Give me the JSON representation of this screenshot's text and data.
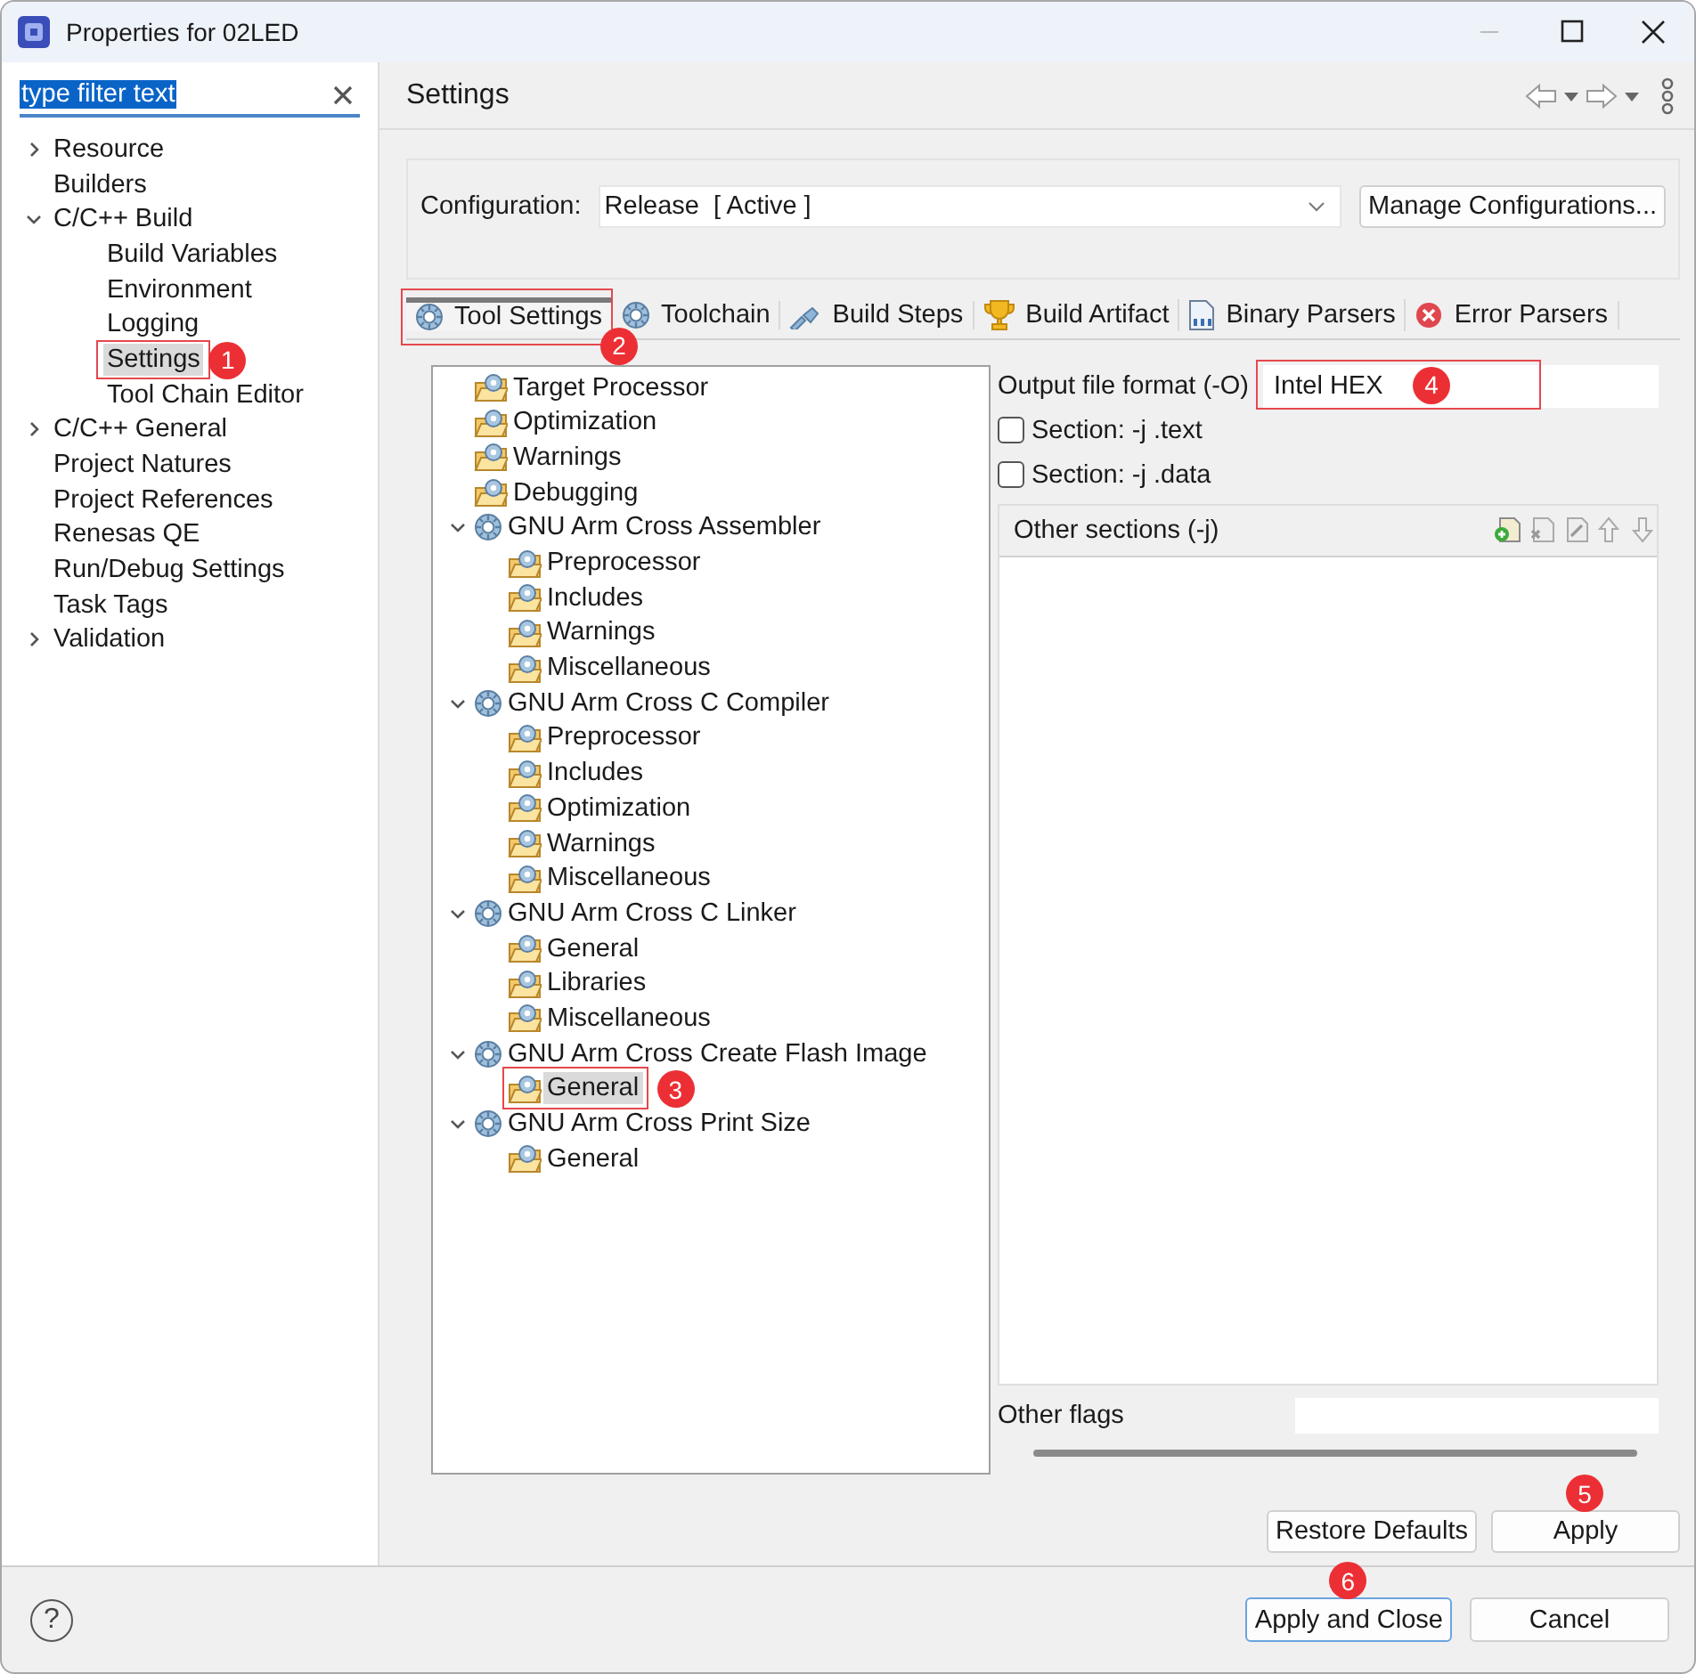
{
  "window": {
    "title": "Properties for 02LED"
  },
  "filter": {
    "value": "type filter text",
    "selected": true
  },
  "sidebar": {
    "items": [
      {
        "label": "Resource",
        "expanded": false,
        "selected": false
      },
      {
        "label": "Builders",
        "selected": false
      },
      {
        "label": "C/C++ Build",
        "expanded": true,
        "selected": false,
        "children": [
          {
            "label": "Build Variables",
            "selected": false
          },
          {
            "label": "Environment",
            "selected": false
          },
          {
            "label": "Logging",
            "selected": false
          },
          {
            "label": "Settings",
            "selected": true,
            "callout": {
              "number": "1",
              "boxed": true
            }
          },
          {
            "label": "Tool Chain Editor",
            "selected": false
          }
        ]
      },
      {
        "label": "C/C++ General",
        "expanded": false,
        "selected": false
      },
      {
        "label": "Project Natures",
        "selected": false
      },
      {
        "label": "Project References",
        "selected": false
      },
      {
        "label": "Renesas QE",
        "selected": false
      },
      {
        "label": "Run/Debug Settings",
        "selected": false
      },
      {
        "label": "Task Tags",
        "selected": false
      },
      {
        "label": "Validation",
        "expanded": false,
        "selected": false
      }
    ]
  },
  "page_title": "Settings",
  "configuration": {
    "label": "Configuration:",
    "value": "Release  [ Active ]",
    "button": "Manage Configurations..."
  },
  "tabs": [
    {
      "label": "Tool Settings",
      "selected": true,
      "callout": {
        "number": "2",
        "boxed": true
      }
    },
    {
      "label": "Toolchain",
      "selected": false
    },
    {
      "label": "Build Steps",
      "selected": false
    },
    {
      "label": "Build Artifact",
      "selected": false
    },
    {
      "label": "Binary Parsers",
      "selected": false
    },
    {
      "label": "Error Parsers",
      "selected": false
    }
  ],
  "tool_tree": {
    "items": [
      {
        "label": "Target Processor",
        "kind": "category",
        "selected": false
      },
      {
        "label": "Optimization",
        "kind": "category",
        "selected": false
      },
      {
        "label": "Warnings",
        "kind": "category",
        "selected": false
      },
      {
        "label": "Debugging",
        "kind": "category",
        "selected": false
      },
      {
        "label": "GNU Arm Cross Assembler",
        "kind": "tool",
        "expanded": true,
        "selected": false,
        "children": [
          {
            "label": "Preprocessor",
            "kind": "category",
            "selected": false
          },
          {
            "label": "Includes",
            "kind": "category",
            "selected": false
          },
          {
            "label": "Warnings",
            "kind": "category",
            "selected": false
          },
          {
            "label": "Miscellaneous",
            "kind": "category",
            "selected": false
          }
        ]
      },
      {
        "label": "GNU Arm Cross C Compiler",
        "kind": "tool",
        "expanded": true,
        "selected": false,
        "children": [
          {
            "label": "Preprocessor",
            "kind": "category",
            "selected": false
          },
          {
            "label": "Includes",
            "kind": "category",
            "selected": false
          },
          {
            "label": "Optimization",
            "kind": "category",
            "selected": false
          },
          {
            "label": "Warnings",
            "kind": "category",
            "selected": false
          },
          {
            "label": "Miscellaneous",
            "kind": "category",
            "selected": false
          }
        ]
      },
      {
        "label": "GNU Arm Cross C Linker",
        "kind": "tool",
        "expanded": true,
        "selected": false,
        "children": [
          {
            "label": "General",
            "kind": "category",
            "selected": false
          },
          {
            "label": "Libraries",
            "kind": "category",
            "selected": false
          },
          {
            "label": "Miscellaneous",
            "kind": "category",
            "selected": false
          }
        ]
      },
      {
        "label": "GNU Arm Cross Create Flash Image",
        "kind": "tool",
        "expanded": true,
        "selected": false,
        "children": [
          {
            "label": "General",
            "kind": "category",
            "selected": true,
            "callout": {
              "number": "3",
              "boxed": true
            }
          }
        ]
      },
      {
        "label": "GNU Arm Cross Print Size",
        "kind": "tool",
        "expanded": true,
        "selected": false,
        "children": [
          {
            "label": "General",
            "kind": "category",
            "selected": false
          }
        ]
      }
    ]
  },
  "options": {
    "output_format": {
      "label": "Output file format (-O)",
      "value": "Intel HEX",
      "callout": {
        "number": "4",
        "boxed": true
      }
    },
    "sections": [
      {
        "label": "Section: -j .text",
        "checked": false
      },
      {
        "label": "Section: -j .data",
        "checked": false
      }
    ],
    "other_sections": {
      "title": "Other sections (-j)"
    },
    "other_flags": {
      "label": "Other flags"
    }
  },
  "page_buttons": [
    {
      "label": "Restore Defaults"
    },
    {
      "label": "Apply",
      "callout": {
        "number": "5",
        "boxed": false
      }
    }
  ],
  "help_button": {
    "label": "?"
  },
  "dialog_buttons": [
    {
      "label": "Apply and Close",
      "default": true,
      "callout": {
        "number": "6",
        "boxed": false
      }
    },
    {
      "label": "Cancel",
      "default": false
    }
  ]
}
